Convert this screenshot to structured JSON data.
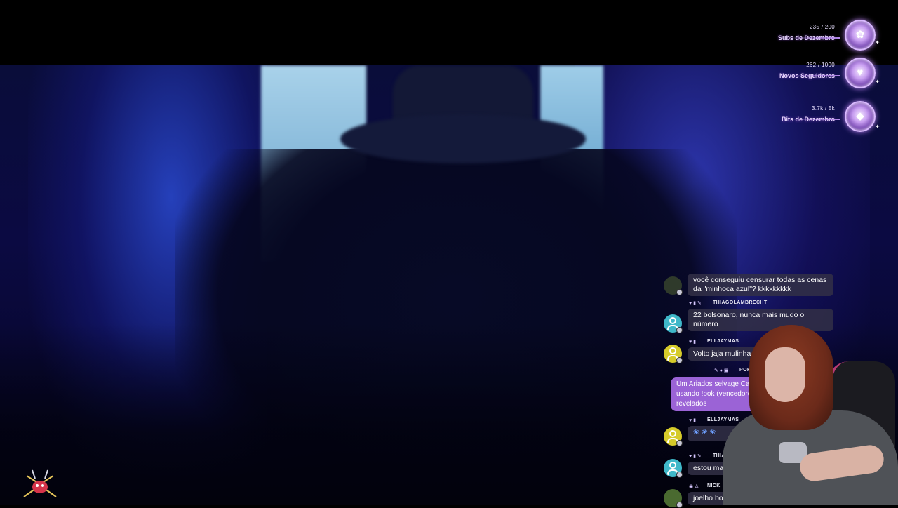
{
  "goals": [
    {
      "count": "235 / 200",
      "label": "Subs de Dezembro",
      "icon": "flower-icon",
      "glyph": "✿"
    },
    {
      "count": "262 / 1000",
      "label": "Novos Seguidores",
      "icon": "heart-icon",
      "glyph": "♥"
    },
    {
      "count": "3.7k / 5k",
      "label": "Bits de Dezembro",
      "icon": "bits-gem-icon",
      "glyph": "◆"
    }
  ],
  "chat": {
    "messages": [
      {
        "user": "",
        "text": "você conseguiu censurar todas as cenas da \"minhoca azul\"? kkkkkkkkk",
        "avatar_color": "#2f3a2b"
      },
      {
        "user": "THIAGOLAMBRECHT",
        "text": "22 bolsonaro, nunca mais mudo o número",
        "avatar_color": "#3fb8c9"
      },
      {
        "user": "ELLJAYMAS",
        "text": "Volto jaja mulinha",
        "avatar_color": "#d6cb2a"
      },
      {
        "user": "POK",
        "text": "Um Ariados selvage Capture-o usando !pok (vencedores revelados",
        "avatar_color": ""
      },
      {
        "user": "ELLJAYMAS",
        "text": "",
        "avatar_color": "#d6cb2a"
      },
      {
        "user": "THIAG",
        "text": "estou ma",
        "avatar_color": "#3fb8c9"
      },
      {
        "user": "NICK",
        "text": "joelho bo",
        "avatar_color": "#4a6a30"
      }
    ]
  },
  "colors": {
    "accent": "#9b63d6",
    "goal_text": "#e9d9ff"
  }
}
